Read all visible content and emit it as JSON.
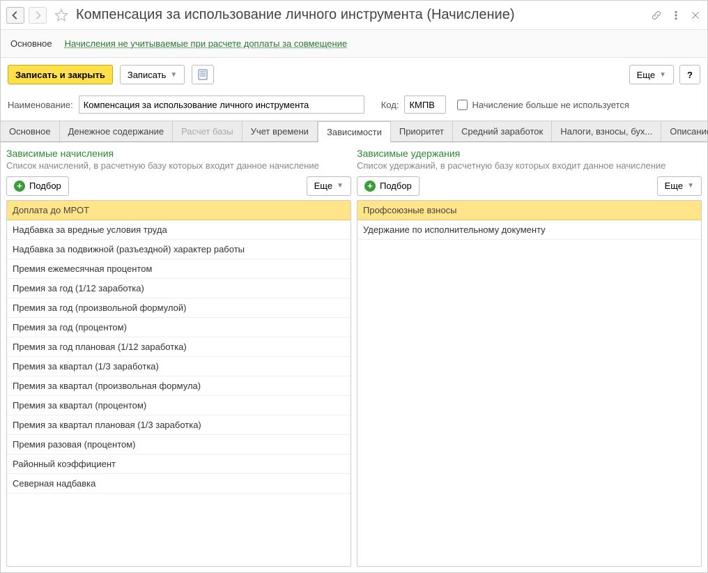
{
  "title": "Компенсация за использование личного инструмента (Начисление)",
  "nav": {
    "tab1": "Основное",
    "link": "Начисления не учитываемые при расчете доплаты за совмещение"
  },
  "toolbar": {
    "save_close": "Записать и закрыть",
    "save": "Записать",
    "more": "Еще",
    "help": "?"
  },
  "form": {
    "name_label": "Наименование:",
    "name_value": "Компенсация за использование личного инструмента",
    "code_label": "Код:",
    "code_value": "КМПВ",
    "not_used_label": "Начисление больше не используется"
  },
  "tabs": [
    {
      "label": "Основное",
      "state": "normal"
    },
    {
      "label": "Денежное содержание",
      "state": "normal"
    },
    {
      "label": "Расчет базы",
      "state": "disabled"
    },
    {
      "label": "Учет времени",
      "state": "normal"
    },
    {
      "label": "Зависимости",
      "state": "active"
    },
    {
      "label": "Приоритет",
      "state": "normal"
    },
    {
      "label": "Средний заработок",
      "state": "normal"
    },
    {
      "label": "Налоги, взносы, бух...",
      "state": "normal"
    },
    {
      "label": "Описание",
      "state": "normal"
    }
  ],
  "left_pane": {
    "title": "Зависимые начисления",
    "subtitle": "Список начислений, в расчетную базу которых входит данное начисление",
    "pick": "Подбор",
    "more": "Еще",
    "header": "Доплата до МРОТ",
    "rows": [
      "Надбавка за вредные условия труда",
      "Надбавка за подвижной (разъездной) характер работы",
      "Премия ежемесячная процентом",
      "Премия за год (1/12 заработка)",
      "Премия за год (произвольной формулой)",
      "Премия за год (процентом)",
      "Премия за год плановая (1/12 заработка)",
      "Премия за квартал (1/3 заработка)",
      "Премия за квартал (произвольная формула)",
      "Премия за квартал (процентом)",
      "Премия за квартал плановая (1/3 заработка)",
      "Премия разовая (процентом)",
      "Районный коэффициент",
      "Северная надбавка"
    ]
  },
  "right_pane": {
    "title": "Зависимые удержания",
    "subtitle": "Список удержаний, в расчетную базу которых входит данное начисление",
    "pick": "Подбор",
    "more": "Еще",
    "header": "Профсоюзные взносы",
    "rows": [
      "Удержание по исполнительному документу"
    ]
  }
}
